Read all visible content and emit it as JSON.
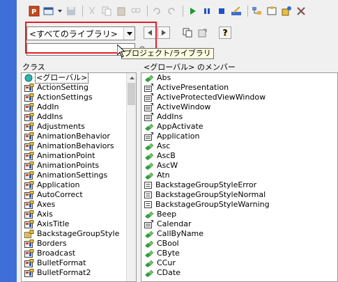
{
  "toolbar": {
    "buttons": [
      "powerpoint-icon",
      "insert-userform-icon",
      "dropdown-arrow-icon",
      "save-icon",
      "cut-icon",
      "copy-icon",
      "paste-icon",
      "find-icon",
      "undo-icon",
      "redo-icon",
      "run-icon",
      "break-icon",
      "reset-icon",
      "design-mode-icon",
      "project-explorer-icon",
      "properties-icon",
      "object-browser-icon",
      "toolbox-icon"
    ]
  },
  "library": {
    "selected": "<すべてのライブラリ>",
    "tooltip": "プロジェクト/ライブラリ",
    "help_glyph": "?"
  },
  "search": {
    "value": ""
  },
  "panes": {
    "classes_header": "クラス",
    "members_header": "<グローバル> のメンバー"
  },
  "classes": [
    {
      "label": "<グローバル>",
      "icon": "globe-icon",
      "selected": true
    },
    {
      "label": "ActionSetting",
      "icon": "class-icon"
    },
    {
      "label": "ActionSettings",
      "icon": "class-icon"
    },
    {
      "label": "AddIn",
      "icon": "class-icon"
    },
    {
      "label": "AddIns",
      "icon": "class-icon"
    },
    {
      "label": "Adjustments",
      "icon": "class-icon"
    },
    {
      "label": "AnimationBehavior",
      "icon": "class-icon"
    },
    {
      "label": "AnimationBehaviors",
      "icon": "class-icon"
    },
    {
      "label": "AnimationPoint",
      "icon": "class-icon"
    },
    {
      "label": "AnimationPoints",
      "icon": "class-icon"
    },
    {
      "label": "AnimationSettings",
      "icon": "class-icon"
    },
    {
      "label": "Application",
      "icon": "class-icon"
    },
    {
      "label": "AutoCorrect",
      "icon": "class-icon"
    },
    {
      "label": "Axes",
      "icon": "class-icon"
    },
    {
      "label": "Axis",
      "icon": "class-icon"
    },
    {
      "label": "AxisTitle",
      "icon": "class-icon"
    },
    {
      "label": "BackstageGroupStyle",
      "icon": "enum-icon"
    },
    {
      "label": "Borders",
      "icon": "class-icon"
    },
    {
      "label": "Broadcast",
      "icon": "class-icon"
    },
    {
      "label": "BulletFormat",
      "icon": "class-icon"
    },
    {
      "label": "BulletFormat2",
      "icon": "class-icon"
    }
  ],
  "members": [
    {
      "label": "Abs",
      "icon": "method-icon"
    },
    {
      "label": "ActivePresentation",
      "icon": "property-icon"
    },
    {
      "label": "ActiveProtectedViewWindow",
      "icon": "property-icon"
    },
    {
      "label": "ActiveWindow",
      "icon": "property-icon"
    },
    {
      "label": "AddIns",
      "icon": "property-icon"
    },
    {
      "label": "AppActivate",
      "icon": "method-icon"
    },
    {
      "label": "Application",
      "icon": "property-icon"
    },
    {
      "label": "Asc",
      "icon": "method-icon"
    },
    {
      "label": "AscB",
      "icon": "method-icon"
    },
    {
      "label": "AscW",
      "icon": "method-icon"
    },
    {
      "label": "Atn",
      "icon": "method-icon"
    },
    {
      "label": "BackstageGroupStyleError",
      "icon": "constant-icon"
    },
    {
      "label": "BackstageGroupStyleNormal",
      "icon": "constant-icon"
    },
    {
      "label": "BackstageGroupStyleWarning",
      "icon": "constant-icon"
    },
    {
      "label": "Beep",
      "icon": "method-icon"
    },
    {
      "label": "Calendar",
      "icon": "property-icon"
    },
    {
      "label": "CallByName",
      "icon": "method-icon"
    },
    {
      "label": "CBool",
      "icon": "method-icon"
    },
    {
      "label": "CByte",
      "icon": "method-icon"
    },
    {
      "label": "CCur",
      "icon": "method-icon"
    },
    {
      "label": "CDate",
      "icon": "method-icon"
    }
  ],
  "colors": {
    "highlight": "#e21f26",
    "run": "#1a9a2a",
    "pause": "#2050c8",
    "stop": "#2050c8",
    "taskbar": "#3e6fd8"
  }
}
